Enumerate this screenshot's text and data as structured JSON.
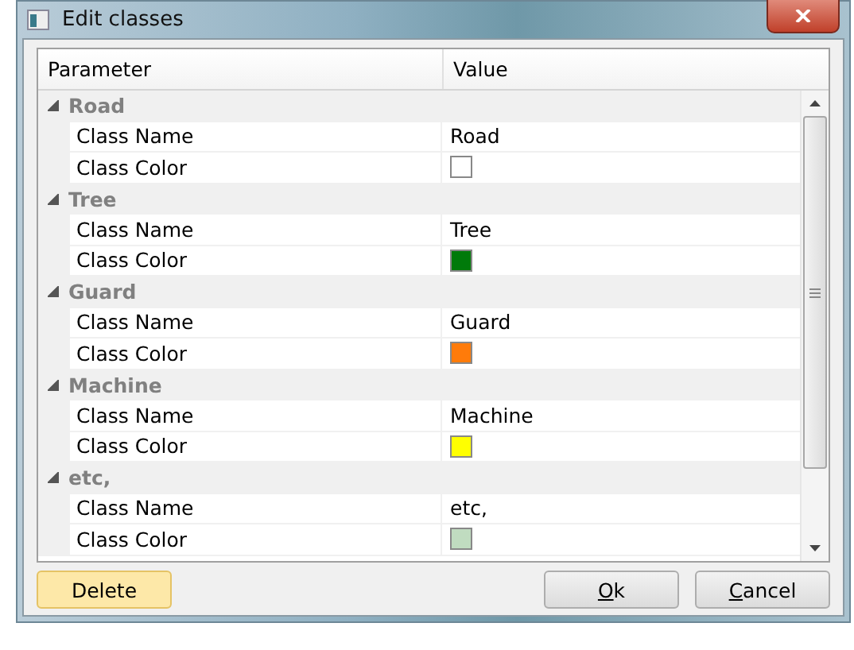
{
  "window": {
    "title": "Edit classes"
  },
  "table": {
    "columns": [
      "Parameter",
      "Value"
    ],
    "categories": [
      {
        "name": "Road",
        "expanded": true,
        "properties": [
          {
            "label": "Class Name",
            "kind": "text",
            "value": "Road"
          },
          {
            "label": "Class Color",
            "kind": "color",
            "color": "#ffffff"
          }
        ]
      },
      {
        "name": "Tree",
        "expanded": true,
        "properties": [
          {
            "label": "Class Name",
            "kind": "text",
            "value": "Tree"
          },
          {
            "label": "Class Color",
            "kind": "color",
            "color": "#007a0a"
          }
        ]
      },
      {
        "name": "Guard",
        "expanded": true,
        "properties": [
          {
            "label": "Class Name",
            "kind": "text",
            "value": "Guard"
          },
          {
            "label": "Class Color",
            "kind": "color",
            "color": "#ff7b0a"
          }
        ]
      },
      {
        "name": "Machine",
        "expanded": true,
        "properties": [
          {
            "label": "Class Name",
            "kind": "text",
            "value": "Machine"
          },
          {
            "label": "Class Color",
            "kind": "color",
            "color": "#ffff00"
          }
        ]
      },
      {
        "name": "etc,",
        "expanded": true,
        "properties": [
          {
            "label": "Class Name",
            "kind": "text",
            "value": "etc,"
          },
          {
            "label": "Class Color",
            "kind": "color",
            "color": "#c0dcc0"
          }
        ]
      }
    ]
  },
  "buttons": [
    {
      "label": "Delete",
      "kind": "highlighted"
    },
    {
      "mnemonic": "O",
      "label_rest": "k",
      "kind": "normal"
    },
    {
      "mnemonic": "C",
      "label_rest": "ancel",
      "kind": "normal"
    }
  ]
}
